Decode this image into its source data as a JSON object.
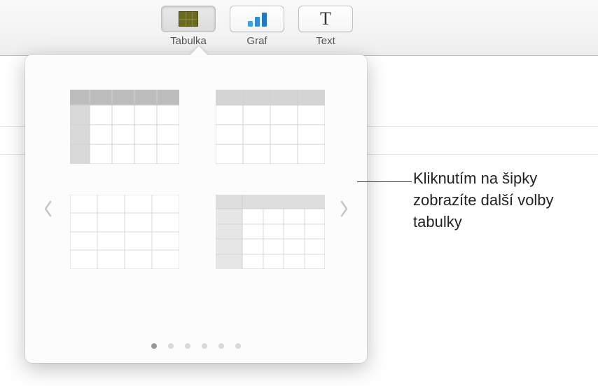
{
  "toolbar": {
    "table": {
      "label": "Tabulka"
    },
    "chart": {
      "label": "Graf"
    },
    "text": {
      "label": "Text",
      "icon_glyph": "T"
    }
  },
  "popover": {
    "pages": 6,
    "current_page": 0
  },
  "annotation": {
    "text": "Kliknutím na šipky zobrazíte další volby tabulky"
  }
}
